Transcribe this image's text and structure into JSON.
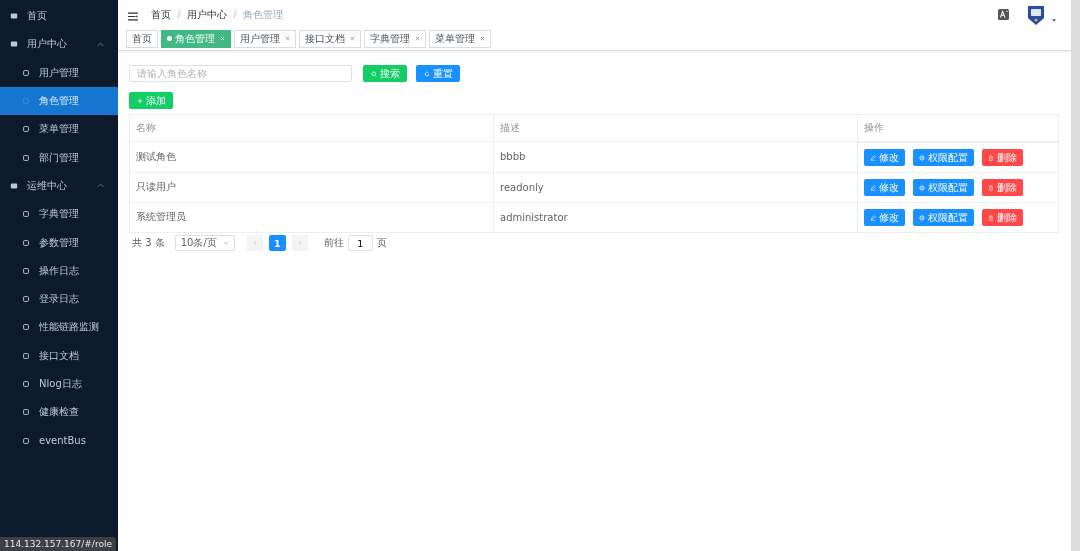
{
  "sidebar": {
    "items": [
      {
        "label": "首页",
        "selected": false
      },
      {
        "label": "用户中心",
        "expanded": true,
        "children": [
          {
            "label": "用户管理",
            "selected": false
          },
          {
            "label": "角色管理",
            "selected": true
          },
          {
            "label": "菜单管理",
            "selected": false
          },
          {
            "label": "部门管理",
            "selected": false
          }
        ]
      },
      {
        "label": "运维中心",
        "expanded": true,
        "children": [
          {
            "label": "字典管理",
            "selected": false
          },
          {
            "label": "参数管理",
            "selected": false
          },
          {
            "label": "操作日志",
            "selected": false
          },
          {
            "label": "登录日志",
            "selected": false
          },
          {
            "label": "性能链路监测",
            "selected": false
          },
          {
            "label": "接口文档",
            "selected": false
          },
          {
            "label": "Nlog日志",
            "selected": false
          },
          {
            "label": "健康检查",
            "selected": false
          },
          {
            "label": "eventBus",
            "selected": false
          }
        ]
      }
    ]
  },
  "breadcrumb": [
    "首页",
    "用户中心",
    "角色管理"
  ],
  "tabs": [
    {
      "label": "首页",
      "selected": false,
      "closable": false
    },
    {
      "label": "角色管理",
      "selected": true,
      "closable": true
    },
    {
      "label": "用户管理",
      "selected": false,
      "closable": true
    },
    {
      "label": "接口文档",
      "selected": false,
      "closable": true
    },
    {
      "label": "字典管理",
      "selected": false,
      "closable": true
    },
    {
      "label": "菜单管理",
      "selected": false,
      "closable": true
    }
  ],
  "search": {
    "placeholder": "请输入角色名称",
    "search_button": "搜索",
    "reset_button": "重置"
  },
  "add_button": "添加",
  "table": {
    "columns": [
      "名称",
      "描述",
      "操作"
    ],
    "rows": [
      {
        "name": "测试角色",
        "description": "bbbb",
        "actions": [
          "修改",
          "权限配置",
          "删除"
        ]
      },
      {
        "name": "只读用户",
        "description": "readonly",
        "actions": [
          "修改",
          "权限配置",
          "删除"
        ]
      },
      {
        "name": "系统管理员",
        "description": "administrator",
        "actions": [
          "修改",
          "权限配置",
          "删除"
        ]
      }
    ]
  },
  "pagination": {
    "total": "共 3 条",
    "page_size": "10条/页",
    "pages": [
      {
        "label": "1",
        "selected": true
      }
    ],
    "goto_label": "前往",
    "goto_value": "1",
    "goto_suffix": "页"
  },
  "status_url": "114.132.157.167/#/role"
}
